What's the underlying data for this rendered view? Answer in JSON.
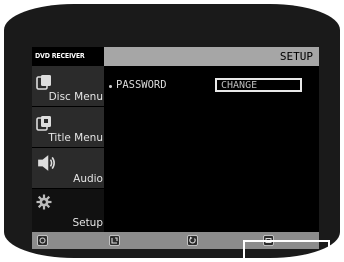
{
  "device": {
    "title": "DVD RECEIVER"
  },
  "header": {
    "title": "SETUP"
  },
  "sidebar": {
    "items": [
      {
        "label": "Disc Menu",
        "icon": "disc-menu-icon",
        "active": false
      },
      {
        "label": "Title Menu",
        "icon": "title-menu-icon",
        "active": false
      },
      {
        "label": "Audio",
        "icon": "speaker-icon",
        "active": false
      },
      {
        "label": "Setup",
        "icon": "gear-icon",
        "active": true
      }
    ]
  },
  "main": {
    "rows": [
      {
        "label": "PASSWORD",
        "value": "CHANGE",
        "selected": true
      }
    ]
  },
  "footer": {
    "buttons": [
      {
        "icon": "navigate-icon"
      },
      {
        "icon": "enter-icon"
      },
      {
        "icon": "return-icon"
      },
      {
        "icon": "menu-icon"
      }
    ]
  },
  "colors": {
    "bezel": "#1a1a1a",
    "screen": "#000000",
    "header_bar": "#a6a6a6",
    "footer_bar": "#8c8c8c",
    "text": "#e6e6e6",
    "highlight_border": "#e8e8e8"
  }
}
